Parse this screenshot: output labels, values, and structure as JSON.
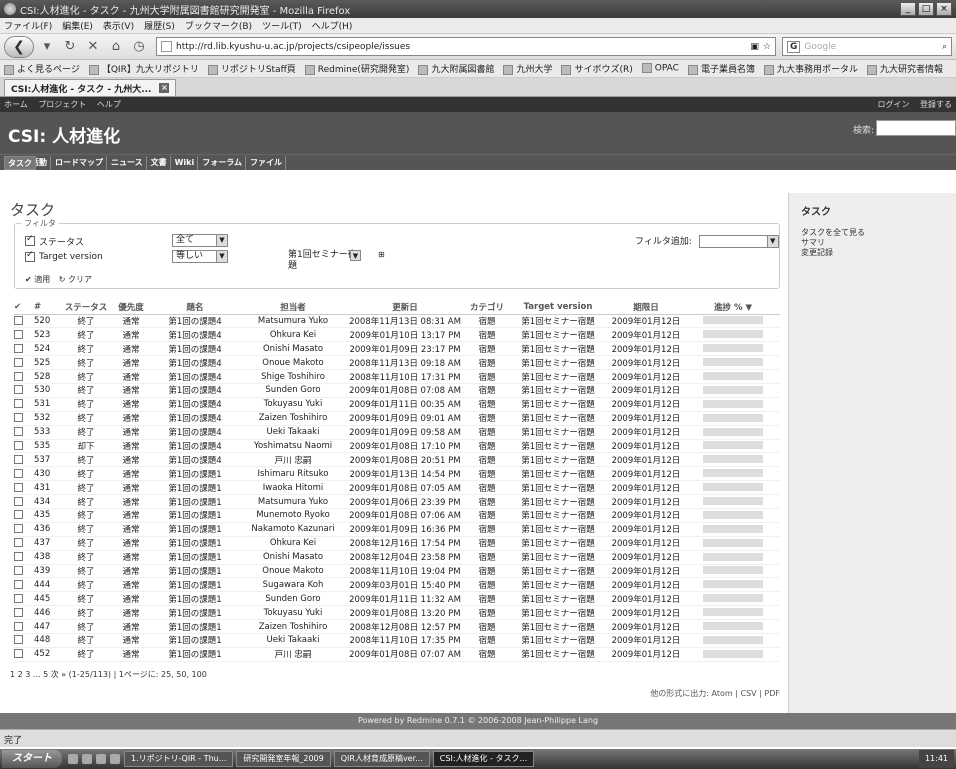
{
  "window": {
    "title": "CSI:人材進化 - タスク - 九州大学附属図書館研究開発室 - Mozilla Firefox"
  },
  "menu": [
    "ファイル(F)",
    "編集(E)",
    "表示(V)",
    "履歴(S)",
    "ブックマーク(B)",
    "ツール(T)",
    "ヘルプ(H)"
  ],
  "nav": {
    "url": "http://rd.lib.kyushu-u.ac.jp/projects/csipeople/issues",
    "search_placeholder": "Google"
  },
  "bookmarks": [
    "よく見るページ",
    "【QIR】九大リポジトリ",
    "リポジトリStaff頁",
    "Redmine(研究開発室)",
    "九大附属図書館",
    "九州大学",
    "サイボウズ(R)",
    "OPAC",
    "電子業員名簿",
    "九大事務用ポータル",
    "九大研究者情報"
  ],
  "tab": {
    "label": "CSI:人材進化 - タスク - 九州大..."
  },
  "topmenu": {
    "left": [
      "ホーム",
      "プロジェクト",
      "ヘルプ"
    ],
    "right": [
      "ログイン",
      "登録する"
    ]
  },
  "header": {
    "title": "CSI: 人材進化",
    "search_label": "検索:"
  },
  "mainmenu": [
    "概要",
    "活動",
    "ロードマップ",
    "タスク",
    "ニュース",
    "文書",
    "Wiki",
    "フォーラム",
    "ファイル"
  ],
  "page": {
    "title": "タスク"
  },
  "filters": {
    "legend": "フィルタ",
    "status_label": "ステータス",
    "status_op": "全て",
    "version_label": "Target version",
    "version_op": "等しい",
    "version_value": "第1回セミナー宿題",
    "add_label": "フィルタ追加:",
    "apply": "適用",
    "clear": "クリア"
  },
  "columns": [
    "#",
    "ステータス",
    "優先度",
    "題名",
    "担当者",
    "更新日",
    "カテゴリ",
    "Target version",
    "期限日",
    "進捗 %"
  ],
  "rows": [
    [
      "520",
      "終了",
      "通常",
      "第1回の課題4",
      "Matsumura Yuko",
      "2008年11月13日 08:31 AM",
      "宿題",
      "第1回セミナー宿題",
      "2009年01月12日"
    ],
    [
      "523",
      "終了",
      "通常",
      "第1回の課題4",
      "Ohkura Kei",
      "2009年01月10日 13:17 PM",
      "宿題",
      "第1回セミナー宿題",
      "2009年01月12日"
    ],
    [
      "524",
      "終了",
      "通常",
      "第1回の課題4",
      "Onishi Masato",
      "2009年01月09日 23:17 PM",
      "宿題",
      "第1回セミナー宿題",
      "2009年01月12日"
    ],
    [
      "525",
      "終了",
      "通常",
      "第1回の課題4",
      "Onoue Makoto",
      "2008年11月13日 09:18 AM",
      "宿題",
      "第1回セミナー宿題",
      "2009年01月12日"
    ],
    [
      "528",
      "終了",
      "通常",
      "第1回の課題4",
      "Shige Toshihiro",
      "2008年11月10日 17:31 PM",
      "宿題",
      "第1回セミナー宿題",
      "2009年01月12日"
    ],
    [
      "530",
      "終了",
      "通常",
      "第1回の課題4",
      "Sunden Goro",
      "2009年01月08日 07:08 AM",
      "宿題",
      "第1回セミナー宿題",
      "2009年01月12日"
    ],
    [
      "531",
      "終了",
      "通常",
      "第1回の課題4",
      "Tokuyasu Yuki",
      "2009年01月11日 00:35 AM",
      "宿題",
      "第1回セミナー宿題",
      "2009年01月12日"
    ],
    [
      "532",
      "終了",
      "通常",
      "第1回の課題4",
      "Zaizen Toshihiro",
      "2009年01月09日 09:01 AM",
      "宿題",
      "第1回セミナー宿題",
      "2009年01月12日"
    ],
    [
      "533",
      "終了",
      "通常",
      "第1回の課題4",
      "Ueki Takaaki",
      "2009年01月09日 09:58 AM",
      "宿題",
      "第1回セミナー宿題",
      "2009年01月12日"
    ],
    [
      "535",
      "却下",
      "通常",
      "第1回の課題4",
      "Yoshimatsu Naomi",
      "2009年01月08日 17:10 PM",
      "宿題",
      "第1回セミナー宿題",
      "2009年01月12日"
    ],
    [
      "537",
      "終了",
      "通常",
      "第1回の課題4",
      "戸川 忠嗣",
      "2009年01月08日 20:51 PM",
      "宿題",
      "第1回セミナー宿題",
      "2009年01月12日"
    ],
    [
      "430",
      "終了",
      "通常",
      "第1回の課題1",
      "Ishimaru Ritsuko",
      "2009年01月13日 14:54 PM",
      "宿題",
      "第1回セミナー宿題",
      "2009年01月12日"
    ],
    [
      "431",
      "終了",
      "通常",
      "第1回の課題1",
      "Iwaoka Hitomi",
      "2009年01月08日 07:05 AM",
      "宿題",
      "第1回セミナー宿題",
      "2009年01月12日"
    ],
    [
      "434",
      "終了",
      "通常",
      "第1回の課題1",
      "Matsumura Yuko",
      "2009年01月06日 23:39 PM",
      "宿題",
      "第1回セミナー宿題",
      "2009年01月12日"
    ],
    [
      "435",
      "終了",
      "通常",
      "第1回の課題1",
      "Munemoto Ryoko",
      "2009年01月08日 07:06 AM",
      "宿題",
      "第1回セミナー宿題",
      "2009年01月12日"
    ],
    [
      "436",
      "終了",
      "通常",
      "第1回の課題1",
      "Nakamoto Kazunari",
      "2009年01月09日 16:36 PM",
      "宿題",
      "第1回セミナー宿題",
      "2009年01月12日"
    ],
    [
      "437",
      "終了",
      "通常",
      "第1回の課題1",
      "Ohkura Kei",
      "2008年12月16日 17:54 PM",
      "宿題",
      "第1回セミナー宿題",
      "2009年01月12日"
    ],
    [
      "438",
      "終了",
      "通常",
      "第1回の課題1",
      "Onishi Masato",
      "2008年12月04日 23:58 PM",
      "宿題",
      "第1回セミナー宿題",
      "2009年01月12日"
    ],
    [
      "439",
      "終了",
      "通常",
      "第1回の課題1",
      "Onoue Makoto",
      "2008年11月10日 19:04 PM",
      "宿題",
      "第1回セミナー宿題",
      "2009年01月12日"
    ],
    [
      "444",
      "終了",
      "通常",
      "第1回の課題1",
      "Sugawara Koh",
      "2009年03月01日 15:40 PM",
      "宿題",
      "第1回セミナー宿題",
      "2009年01月12日"
    ],
    [
      "445",
      "終了",
      "通常",
      "第1回の課題1",
      "Sunden Goro",
      "2009年01月11日 11:32 AM",
      "宿題",
      "第1回セミナー宿題",
      "2009年01月12日"
    ],
    [
      "446",
      "終了",
      "通常",
      "第1回の課題1",
      "Tokuyasu Yuki",
      "2009年01月08日 13:20 PM",
      "宿題",
      "第1回セミナー宿題",
      "2009年01月12日"
    ],
    [
      "447",
      "終了",
      "通常",
      "第1回の課題1",
      "Zaizen Toshihiro",
      "2008年12月08日 12:57 PM",
      "宿題",
      "第1回セミナー宿題",
      "2009年01月12日"
    ],
    [
      "448",
      "終了",
      "通常",
      "第1回の課題1",
      "Ueki Takaaki",
      "2008年11月10日 17:35 PM",
      "宿題",
      "第1回セミナー宿題",
      "2009年01月12日"
    ],
    [
      "452",
      "終了",
      "通常",
      "第1回の課題1",
      "戸川 忠嗣",
      "2009年01月08日 07:07 AM",
      "宿題",
      "第1回セミナー宿題",
      "2009年01月12日"
    ]
  ],
  "pager": "1 2 3 ... 5 次 » (1-25/113) | 1ページに: 25, 50, 100",
  "export": "他の形式に出力: Atom | CSV | PDF",
  "sidebar": {
    "title": "タスク",
    "links": [
      "タスクを全て見る",
      "サマリ",
      "変更記録"
    ]
  },
  "footer": "Powered by Redmine 0.7.1 © 2006-2008 Jean-Philippe Lang",
  "status": "完了",
  "taskbar": {
    "start": "スタート",
    "items": [
      "1.リポジトリ-QIR - Thu...",
      "研究開発室年報_2009",
      "QIR人材育成原稿ver...",
      "CSI:人材進化 - タスク..."
    ],
    "clock": "11:41"
  }
}
